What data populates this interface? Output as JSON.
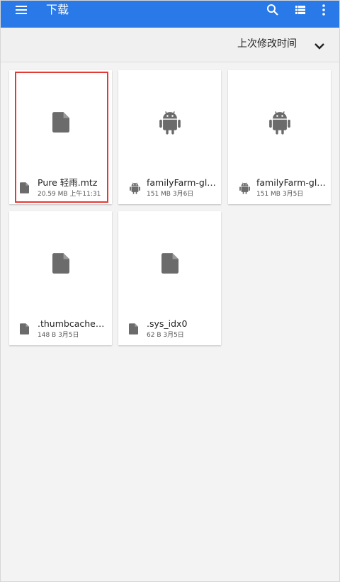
{
  "appbar": {
    "title": "下载",
    "menu_icon": "menu-icon",
    "search_icon": "search-icon",
    "view_icon": "list-view-icon",
    "more_icon": "more-vert-icon",
    "color": "#2979e8"
  },
  "sortbar": {
    "label": "上次修改时间",
    "chevron_icon": "chevron-down-icon"
  },
  "files": [
    {
      "name": "Pure 轻雨.mtz",
      "meta": "20.59 MB 上午11:31",
      "type": "file",
      "selected": true
    },
    {
      "name": "familyFarm-glo…",
      "meta": "151 MB 3月6日",
      "type": "android",
      "selected": false
    },
    {
      "name": "familyFarm-glo…",
      "meta": "151 MB 3月5日",
      "type": "android",
      "selected": false
    },
    {
      "name": ".thumbcache_0…",
      "meta": "148 B 3月5日",
      "type": "file",
      "selected": false
    },
    {
      "name": ".sys_idx0",
      "meta": "62 B 3月5日",
      "type": "file",
      "selected": false
    }
  ],
  "colors": {
    "selection": "#e53935",
    "icon_grey": "#6b6b6b"
  }
}
